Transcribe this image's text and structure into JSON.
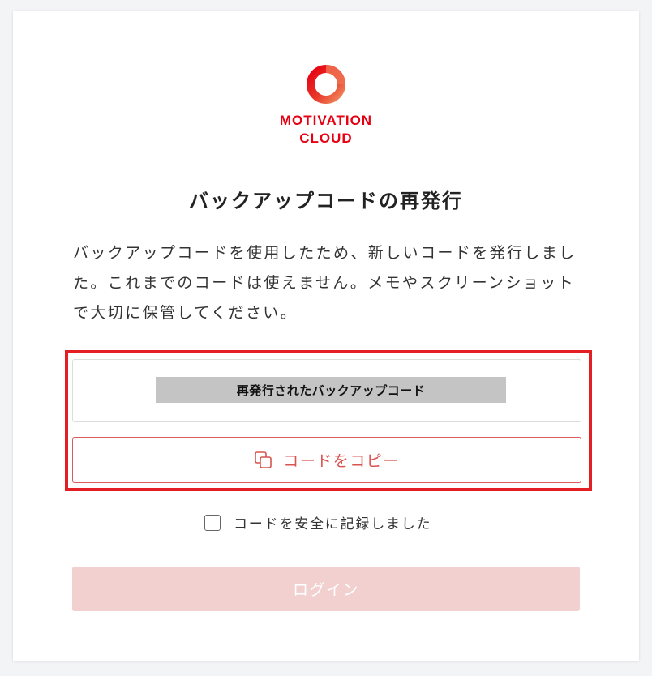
{
  "brand": {
    "line1": "MOTIVATION",
    "line2": "CLOUD",
    "color": "#e60012"
  },
  "page_title": "バックアップコードの再発行",
  "description": "バックアップコードを使用したため、新しいコードを発行しました。これまでのコードは使えません。メモやスクリーンショットで大切に保管してください。",
  "code_box": {
    "label": "再発行されたバックアップコード"
  },
  "copy_button": {
    "icon": "copy-icon",
    "label": "コードをコピー"
  },
  "confirm_checkbox": {
    "label": "コードを安全に記録しました",
    "checked": false
  },
  "login_button": {
    "label": "ログイン",
    "disabled": true
  },
  "colors": {
    "accent": "#e41e25",
    "disabled_button": "#f2d0d0",
    "copy_text": "#d9534f"
  }
}
